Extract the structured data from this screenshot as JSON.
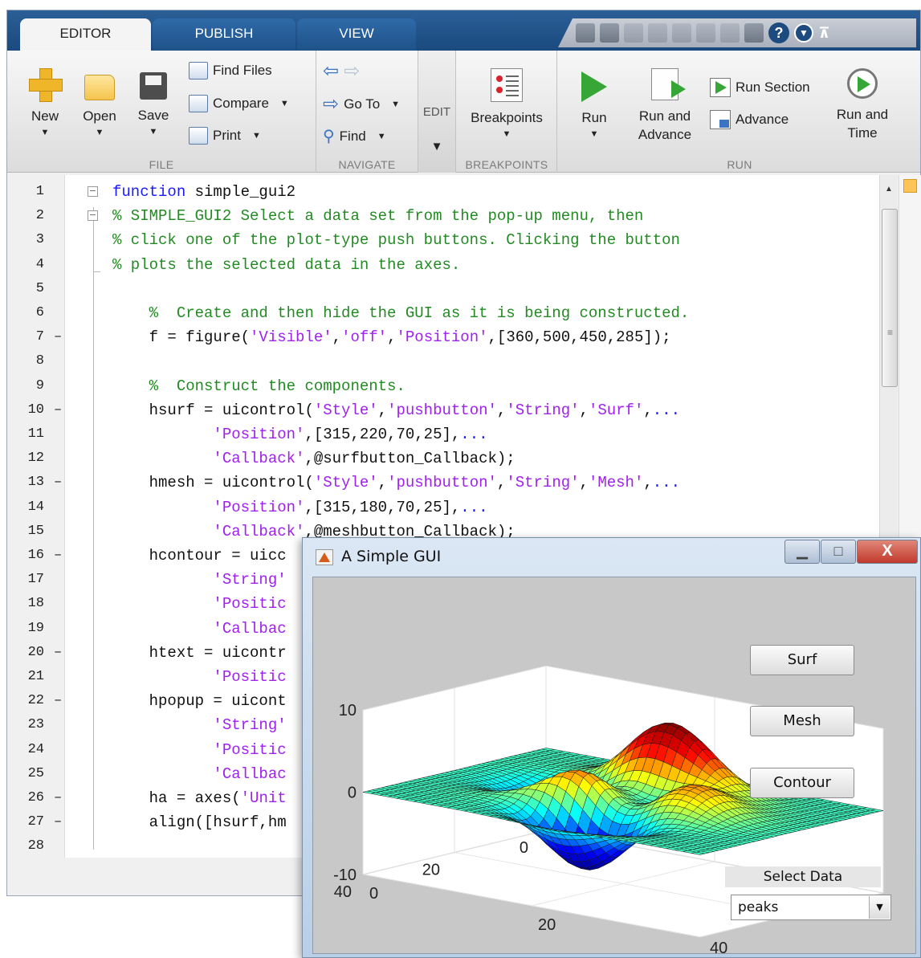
{
  "editor": {
    "tabs": [
      {
        "label": "EDITOR",
        "active": true
      },
      {
        "label": "PUBLISH",
        "active": false
      },
      {
        "label": "VIEW",
        "active": false
      }
    ],
    "quick_access": {
      "icons": [
        "paste-icon",
        "save-icon",
        "cut-icon",
        "copy-icon",
        "paste-icon",
        "undo-icon",
        "redo-icon",
        "switch-windows-icon",
        "help-icon",
        "dropdown-icon",
        "pin-icon"
      ],
      "help_label": "?",
      "dropdown_label": "▼",
      "pin_label": "⊼"
    },
    "ribbon": {
      "file": {
        "section_label": "FILE",
        "new_label": "New",
        "open_label": "Open",
        "save_label": "Save",
        "find_files_label": "Find Files",
        "compare_label": "Compare",
        "print_label": "Print"
      },
      "navigate": {
        "section_label": "NAVIGATE",
        "go_to_label": "Go To",
        "find_label": "Find"
      },
      "edit": {
        "section_label": "EDIT"
      },
      "breakpoints": {
        "section_label": "BREAKPOINTS",
        "breakpoints_label": "Breakpoints"
      },
      "run": {
        "section_label": "RUN",
        "run_label": "Run",
        "run_and_advance_label_1": "Run and",
        "run_and_advance_label_2": "Advance",
        "run_section_label": "Run Section",
        "advance_label": "Advance",
        "run_and_time_label_1": "Run and",
        "run_and_time_label_2": "Time"
      }
    },
    "code_lines": [
      {
        "n": "1",
        "dash": "",
        "parts": [
          {
            "t": "kw",
            "s": "function"
          },
          {
            "t": "tx",
            "s": " simple_gui2"
          }
        ]
      },
      {
        "n": "2",
        "dash": "",
        "parts": [
          {
            "t": "cm",
            "s": "% SIMPLE_GUI2 Select a data set from the pop-up menu, then"
          }
        ]
      },
      {
        "n": "3",
        "dash": "",
        "parts": [
          {
            "t": "cm",
            "s": "% click one of the plot-type push buttons. Clicking the button"
          }
        ]
      },
      {
        "n": "4",
        "dash": "",
        "parts": [
          {
            "t": "cm",
            "s": "% plots the selected data in the axes."
          }
        ]
      },
      {
        "n": "5",
        "dash": "",
        "parts": []
      },
      {
        "n": "6",
        "dash": "",
        "parts": [
          {
            "t": "cm",
            "s": "    %  Create and then hide the GUI as it is being constructed."
          }
        ]
      },
      {
        "n": "7",
        "dash": "–",
        "parts": [
          {
            "t": "tx",
            "s": "    f = figure("
          },
          {
            "t": "st",
            "s": "'Visible'"
          },
          {
            "t": "tx",
            "s": ","
          },
          {
            "t": "st",
            "s": "'off'"
          },
          {
            "t": "tx",
            "s": ","
          },
          {
            "t": "st",
            "s": "'Position'"
          },
          {
            "t": "tx",
            "s": ",[360,500,450,285]);"
          }
        ]
      },
      {
        "n": "8",
        "dash": "",
        "parts": []
      },
      {
        "n": "9",
        "dash": "",
        "parts": [
          {
            "t": "cm",
            "s": "    %  Construct the components."
          }
        ]
      },
      {
        "n": "10",
        "dash": "–",
        "parts": [
          {
            "t": "tx",
            "s": "    hsurf = uicontrol("
          },
          {
            "t": "st",
            "s": "'Style'"
          },
          {
            "t": "tx",
            "s": ","
          },
          {
            "t": "st",
            "s": "'pushbutton'"
          },
          {
            "t": "tx",
            "s": ","
          },
          {
            "t": "st",
            "s": "'String'"
          },
          {
            "t": "tx",
            "s": ","
          },
          {
            "t": "st",
            "s": "'Surf'"
          },
          {
            "t": "tx",
            "s": ","
          },
          {
            "t": "kw",
            "s": "..."
          }
        ]
      },
      {
        "n": "11",
        "dash": "",
        "parts": [
          {
            "t": "tx",
            "s": "           "
          },
          {
            "t": "st",
            "s": "'Position'"
          },
          {
            "t": "tx",
            "s": ",[315,220,70,25],"
          },
          {
            "t": "kw",
            "s": "..."
          }
        ]
      },
      {
        "n": "12",
        "dash": "",
        "parts": [
          {
            "t": "tx",
            "s": "           "
          },
          {
            "t": "st",
            "s": "'Callback'"
          },
          {
            "t": "tx",
            "s": ",@surfbutton_Callback);"
          }
        ]
      },
      {
        "n": "13",
        "dash": "–",
        "parts": [
          {
            "t": "tx",
            "s": "    hmesh = uicontrol("
          },
          {
            "t": "st",
            "s": "'Style'"
          },
          {
            "t": "tx",
            "s": ","
          },
          {
            "t": "st",
            "s": "'pushbutton'"
          },
          {
            "t": "tx",
            "s": ","
          },
          {
            "t": "st",
            "s": "'String'"
          },
          {
            "t": "tx",
            "s": ","
          },
          {
            "t": "st",
            "s": "'Mesh'"
          },
          {
            "t": "tx",
            "s": ","
          },
          {
            "t": "kw",
            "s": "..."
          }
        ]
      },
      {
        "n": "14",
        "dash": "",
        "parts": [
          {
            "t": "tx",
            "s": "           "
          },
          {
            "t": "st",
            "s": "'Position'"
          },
          {
            "t": "tx",
            "s": ",[315,180,70,25],"
          },
          {
            "t": "kw",
            "s": "..."
          }
        ]
      },
      {
        "n": "15",
        "dash": "",
        "parts": [
          {
            "t": "tx",
            "s": "           "
          },
          {
            "t": "st",
            "s": "'Callback'"
          },
          {
            "t": "tx",
            "s": ",@meshbutton_Callback);"
          }
        ]
      },
      {
        "n": "16",
        "dash": "–",
        "parts": [
          {
            "t": "tx",
            "s": "    hcontour = uicc"
          }
        ]
      },
      {
        "n": "17",
        "dash": "",
        "parts": [
          {
            "t": "tx",
            "s": "           "
          },
          {
            "t": "st",
            "s": "'String'"
          }
        ]
      },
      {
        "n": "18",
        "dash": "",
        "parts": [
          {
            "t": "tx",
            "s": "           "
          },
          {
            "t": "st",
            "s": "'Positic"
          }
        ]
      },
      {
        "n": "19",
        "dash": "",
        "parts": [
          {
            "t": "tx",
            "s": "           "
          },
          {
            "t": "st",
            "s": "'Callbac"
          }
        ]
      },
      {
        "n": "20",
        "dash": "–",
        "parts": [
          {
            "t": "tx",
            "s": "    htext = uicontr"
          }
        ]
      },
      {
        "n": "21",
        "dash": "",
        "parts": [
          {
            "t": "tx",
            "s": "           "
          },
          {
            "t": "st",
            "s": "'Positic"
          }
        ]
      },
      {
        "n": "22",
        "dash": "–",
        "parts": [
          {
            "t": "tx",
            "s": "    hpopup = uicont"
          }
        ]
      },
      {
        "n": "23",
        "dash": "",
        "parts": [
          {
            "t": "tx",
            "s": "           "
          },
          {
            "t": "st",
            "s": "'String'"
          }
        ]
      },
      {
        "n": "24",
        "dash": "",
        "parts": [
          {
            "t": "tx",
            "s": "           "
          },
          {
            "t": "st",
            "s": "'Positic"
          }
        ]
      },
      {
        "n": "25",
        "dash": "",
        "parts": [
          {
            "t": "tx",
            "s": "           "
          },
          {
            "t": "st",
            "s": "'Callbac"
          }
        ]
      },
      {
        "n": "26",
        "dash": "–",
        "parts": [
          {
            "t": "tx",
            "s": "    ha = axes("
          },
          {
            "t": "st",
            "s": "'Unit"
          }
        ]
      },
      {
        "n": "27",
        "dash": "–",
        "parts": [
          {
            "t": "tx",
            "s": "    align([hsurf,hm"
          }
        ]
      },
      {
        "n": "28",
        "dash": "",
        "parts": []
      }
    ]
  },
  "figure_window": {
    "title": "A Simple GUI",
    "minimize_label": "▁",
    "maximize_label": "□",
    "close_label": "X",
    "surf_button_label": "Surf",
    "mesh_button_label": "Mesh",
    "contour_button_label": "Contour",
    "select_data_label": "Select Data",
    "popup_value": "peaks",
    "popup_arrow": "▼"
  },
  "chart_data": {
    "type": "surface",
    "function": "peaks",
    "title": "",
    "zlim": [
      -10,
      10
    ],
    "xlim": [
      0,
      40
    ],
    "ylim": [
      0,
      40
    ],
    "z_ticks": [
      "10",
      "0",
      "-10"
    ],
    "y_ticks": [
      "40",
      "20",
      "0"
    ],
    "x_ticks": [
      "0",
      "20",
      "40"
    ],
    "colormap": [
      "#000080",
      "#0000ff",
      "#00ffff",
      "#ffff00",
      "#ff0000",
      "#800000"
    ]
  }
}
